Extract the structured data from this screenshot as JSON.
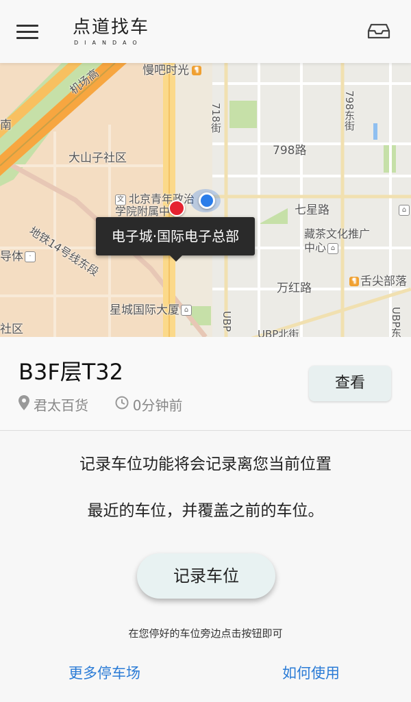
{
  "header": {
    "title": "点道找车",
    "subtitle": "DIANDAO",
    "menu_icon": "menu-icon",
    "inbox_icon": "inbox-icon"
  },
  "map": {
    "labels": {
      "top_poi": "慢吧时光",
      "airport_road": "机场高",
      "nan": "南",
      "dashanzi": "大山子社区",
      "school": "北京青年政治学院附属中学",
      "line14": "地铁14号线东段",
      "road718": "718街",
      "road798_street": "798东街",
      "road798": "798路",
      "qixing": "七星路",
      "zangcha": "藏茶文化推广中心",
      "tiyu": "导体",
      "wanhong": "万红路",
      "shejian": "舌尖部落",
      "xingcheng": "星城国际大厦",
      "shequ": "社区",
      "ubp1": "UBP",
      "ubp_north": "UBP北街",
      "ubp2": "UBP东"
    },
    "tooltip": "电子城·国际电子总部",
    "colors": {
      "land": "#efe9dc",
      "road_orange": "#f7a640",
      "road_yellow": "#fbd98a",
      "green": "#c6e0a8",
      "water": "#8fbff0",
      "pin": "#e52330",
      "location": "#2b7de9"
    }
  },
  "parking": {
    "spot": "B3F层T32",
    "location": "君太百货",
    "time": "0分钟前",
    "view_button": "查看",
    "location_icon": "map-pin-icon",
    "time_icon": "clock-icon"
  },
  "description": {
    "line1": "记录车位功能将会记录离您当前位置",
    "line2": "最近的车位，并覆盖之前的车位。"
  },
  "record_button": "记录车位",
  "hint": "在您停好的车位旁边点击按钮即可",
  "links": {
    "more_parking": "更多停车场",
    "how_to_use": "如何使用"
  }
}
